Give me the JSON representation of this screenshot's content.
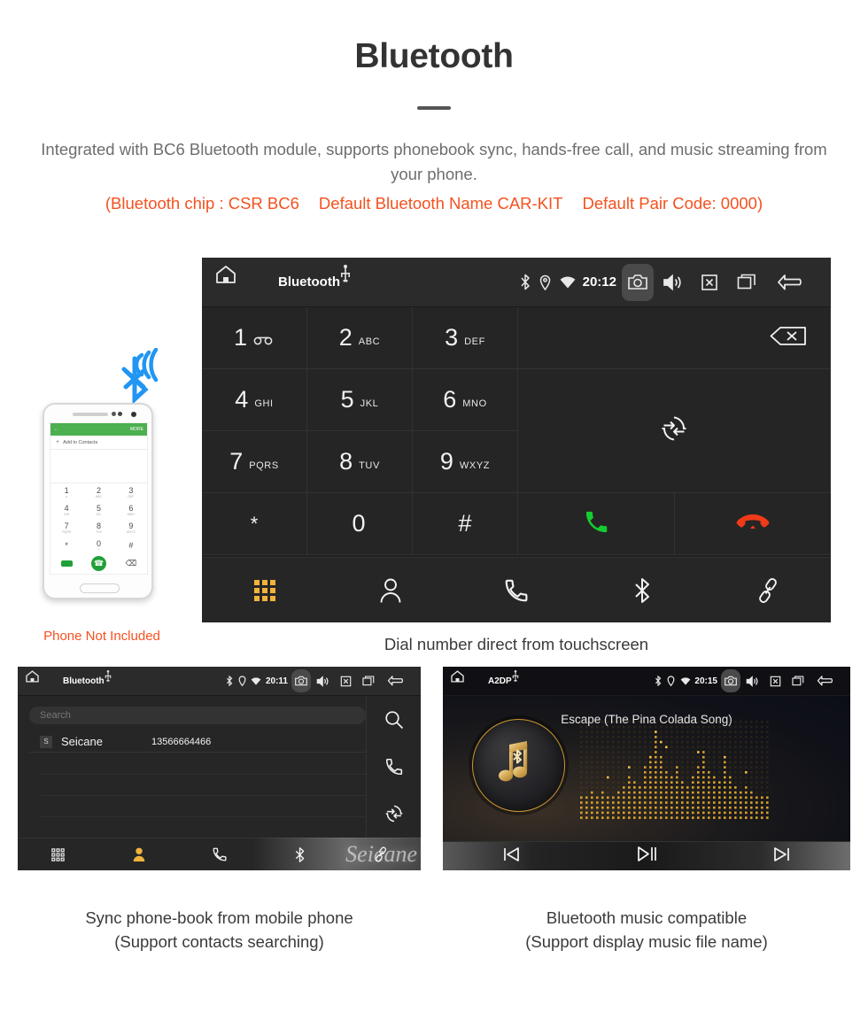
{
  "header": {
    "title": "Bluetooth",
    "description": "Integrated with BC6 Bluetooth module, supports phonebook sync, hands-free call, and music streaming from your phone.",
    "spec_chip": "(Bluetooth chip : CSR BC6",
    "spec_name": "Default Bluetooth Name CAR-KIT",
    "spec_pair": "Default Pair Code: 0000)",
    "accent_color": "#f4511e",
    "body_color": "#6d6d6d"
  },
  "main_panel": {
    "topbar": {
      "title": "Bluetooth",
      "clock": "20:12",
      "icons": [
        "home-icon",
        "usb-icon",
        "bluetooth-icon",
        "location-icon",
        "wifi-icon",
        "camera-icon",
        "volume-icon",
        "close-box-icon",
        "recents-icon",
        "back-icon"
      ]
    },
    "keys": [
      {
        "digit": "1",
        "sub": "voicemail"
      },
      {
        "digit": "2",
        "sub": "ABC"
      },
      {
        "digit": "3",
        "sub": "DEF"
      },
      {
        "digit": "4",
        "sub": "GHI"
      },
      {
        "digit": "5",
        "sub": "JKL"
      },
      {
        "digit": "6",
        "sub": "MNO"
      },
      {
        "digit": "7",
        "sub": "PQRS"
      },
      {
        "digit": "8",
        "sub": "TUV"
      },
      {
        "digit": "9",
        "sub": "WXYZ"
      },
      {
        "digit": "*",
        "sub": ""
      },
      {
        "digit": "0",
        "sub": "+"
      },
      {
        "digit": "#",
        "sub": ""
      }
    ],
    "side_actions": [
      "backspace-icon",
      "sync-transfer-icon",
      "call-answer-icon",
      "call-end-icon"
    ],
    "nav": [
      {
        "name": "keypad",
        "active": true
      },
      {
        "name": "contacts",
        "active": false
      },
      {
        "name": "call-log",
        "active": false
      },
      {
        "name": "bluetooth",
        "active": false
      },
      {
        "name": "link",
        "active": false
      }
    ],
    "active_color": "#f0b43c",
    "caption": "Dial number direct from touchscreen"
  },
  "phone_illustration": {
    "screen_header_action": "MORE",
    "add_contacts_label": "Add to Contacts",
    "keys": [
      "1",
      "2",
      "3",
      "4",
      "5",
      "6",
      "7",
      "8",
      "9",
      "*",
      "0",
      "#"
    ],
    "key_subs": [
      "∞",
      "ABC",
      "DEF",
      "GHI",
      "JKL",
      "MNO",
      "PQRS",
      "TUV",
      "WXYZ",
      "",
      "+",
      ""
    ],
    "not_included_label": "Phone Not Included"
  },
  "contacts_panel": {
    "topbar": {
      "title": "Bluetooth",
      "clock": "20:11"
    },
    "search_placeholder": "Search",
    "contact": {
      "initial": "S",
      "name": "Seicane",
      "number": "13566664466"
    },
    "rail_actions": [
      "search-icon",
      "call-icon",
      "sync-icon"
    ],
    "nav": [
      {
        "name": "keypad",
        "active": false
      },
      {
        "name": "contacts",
        "active": true
      },
      {
        "name": "call-log",
        "active": false
      },
      {
        "name": "bluetooth",
        "active": false
      },
      {
        "name": "link",
        "active": false
      }
    ],
    "watermark": "Seicane",
    "caption_line1": "Sync phone-book from mobile phone",
    "caption_line2": "(Support contacts searching)"
  },
  "music_panel": {
    "topbar": {
      "title": "A2DP",
      "clock": "20:15"
    },
    "song_title": "Escape (The Pina Colada Song)",
    "controls": [
      "previous-track-icon",
      "play-pause-icon",
      "next-track-icon"
    ],
    "accent_color": "#c9952f",
    "caption_line1": "Bluetooth music compatible",
    "caption_line2": "(Support display music file name)"
  }
}
